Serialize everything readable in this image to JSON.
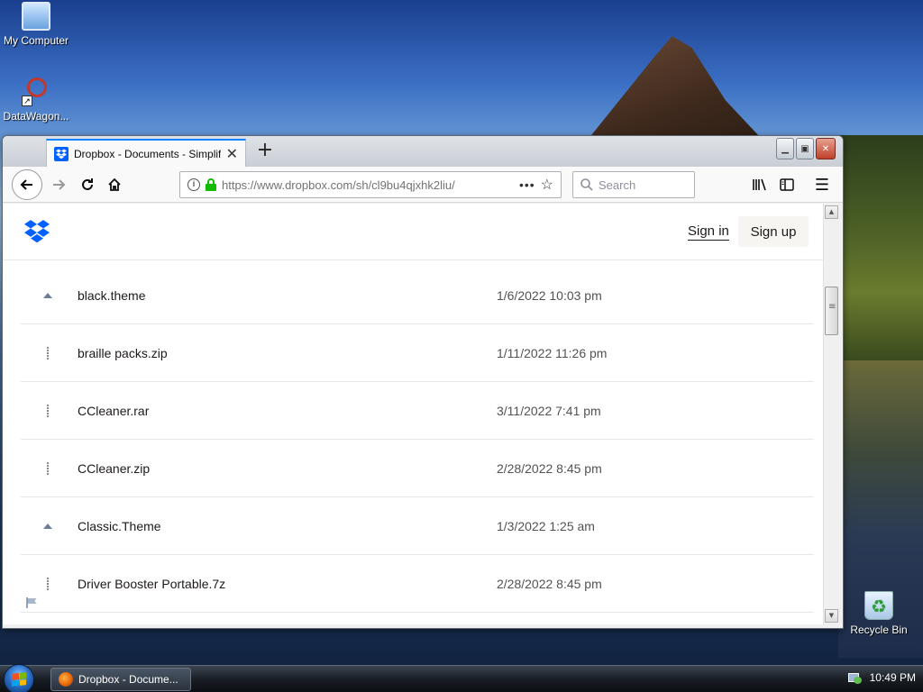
{
  "desktop": {
    "icons": [
      {
        "label": "My Computer"
      },
      {
        "label": "DataWagon..."
      },
      {
        "label": "Recycle Bin"
      }
    ]
  },
  "browser": {
    "tab": {
      "title": "Dropbox - Documents - Simplif"
    },
    "url": "https://www.dropbox.com/sh/cl9bu4qjxhk2liu/",
    "search_placeholder": "Search"
  },
  "page": {
    "header": {
      "sign_in": "Sign in",
      "sign_up": "Sign up"
    },
    "files": [
      {
        "name": "black.theme",
        "modified": "1/6/2022 10:03 pm",
        "icon": "theme-file-icon"
      },
      {
        "name": "braille packs.zip",
        "modified": "1/11/2022 11:26 pm",
        "icon": "archive-file-icon"
      },
      {
        "name": "CCleaner.rar",
        "modified": "3/11/2022 7:41 pm",
        "icon": "archive-file-icon"
      },
      {
        "name": "CCleaner.zip",
        "modified": "2/28/2022 8:45 pm",
        "icon": "archive-file-icon"
      },
      {
        "name": "Classic.Theme",
        "modified": "1/3/2022 1:25 am",
        "icon": "theme-file-icon"
      },
      {
        "name": "Driver Booster Portable.7z",
        "modified": "2/28/2022 8:45 pm",
        "icon": "archive-file-icon"
      }
    ]
  },
  "taskbar": {
    "task_label": "Dropbox - Docume...",
    "clock": "10:49 PM"
  },
  "colors": {
    "dropbox_blue": "#0061fe",
    "tab_accent": "#0a84ff",
    "lock_green": "#12bc00"
  }
}
